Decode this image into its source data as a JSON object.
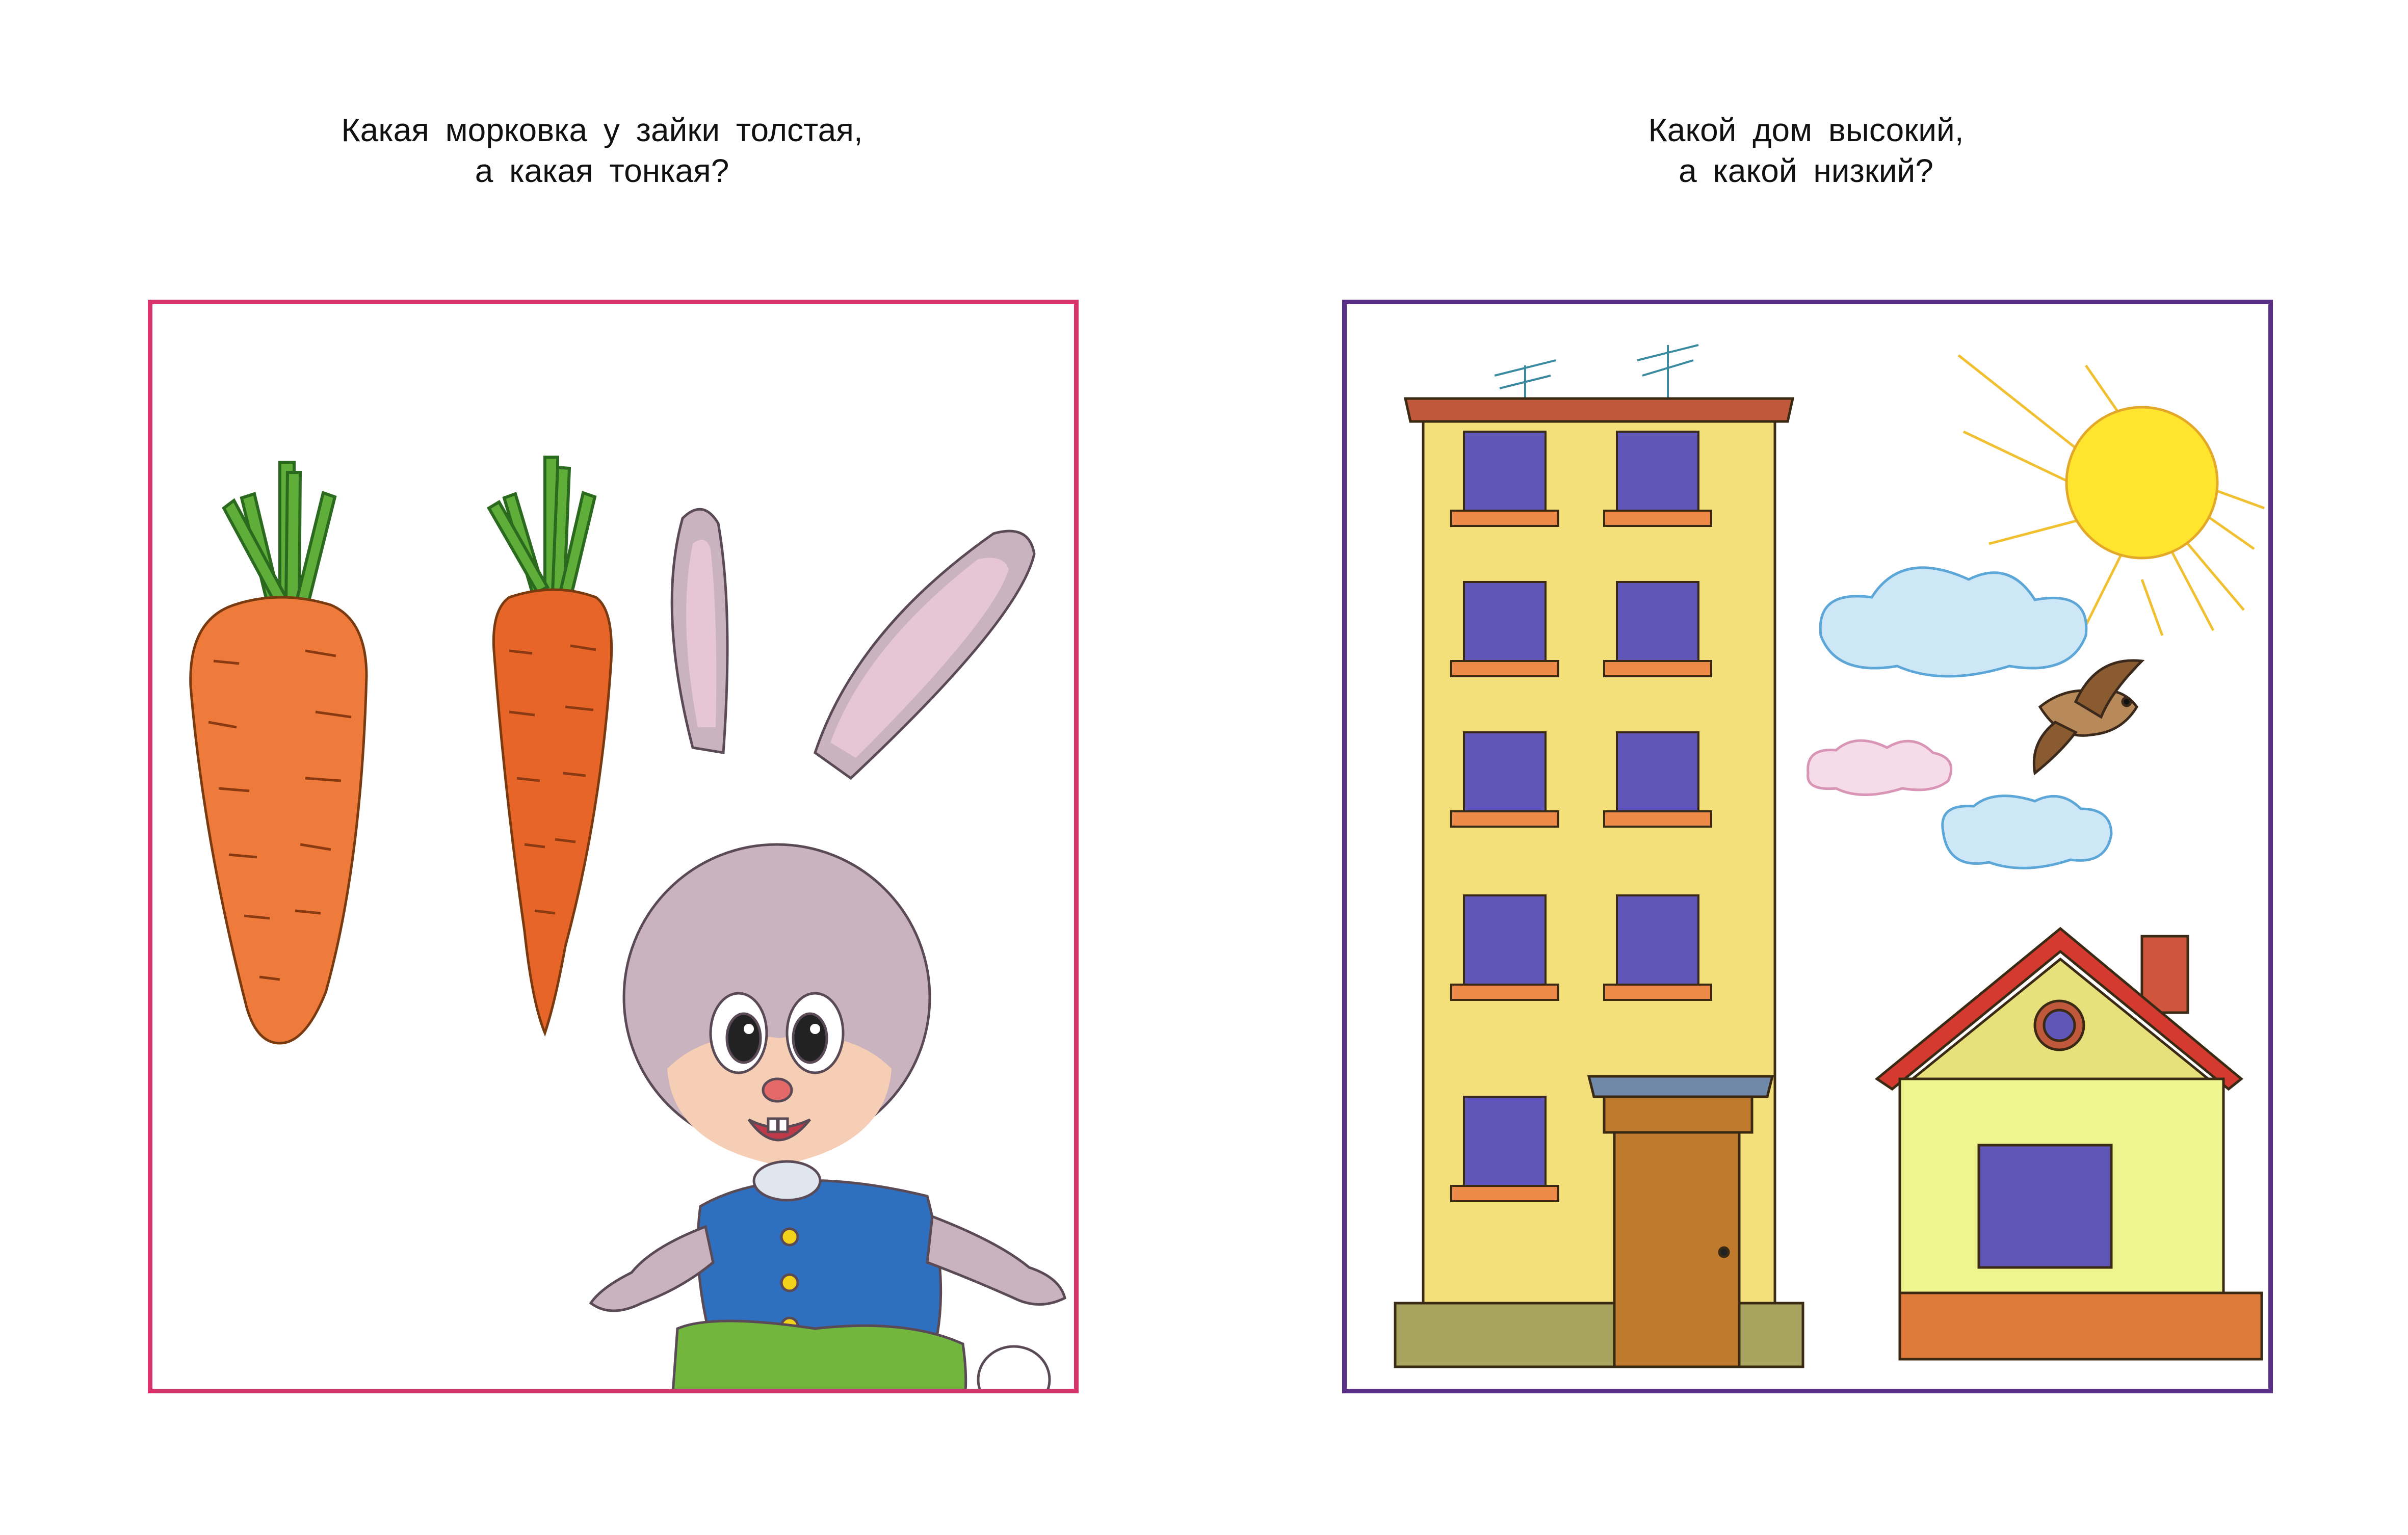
{
  "left_page": {
    "question": {
      "line1": "Какая морковка у зайки толстая,",
      "line2": "а какая тонкая?"
    },
    "frame_color": "#d8336d",
    "illustration": [
      "carrot-thick-icon",
      "carrot-thin-icon",
      "bunny-icon"
    ]
  },
  "right_page": {
    "question": {
      "line1": "Какой дом высокий,",
      "line2": "а какой низкий?"
    },
    "frame_color": "#5a2f86",
    "illustration": [
      "tall-building-icon",
      "small-house-icon",
      "sun-icon",
      "cloud-icon",
      "bird-icon"
    ]
  }
}
